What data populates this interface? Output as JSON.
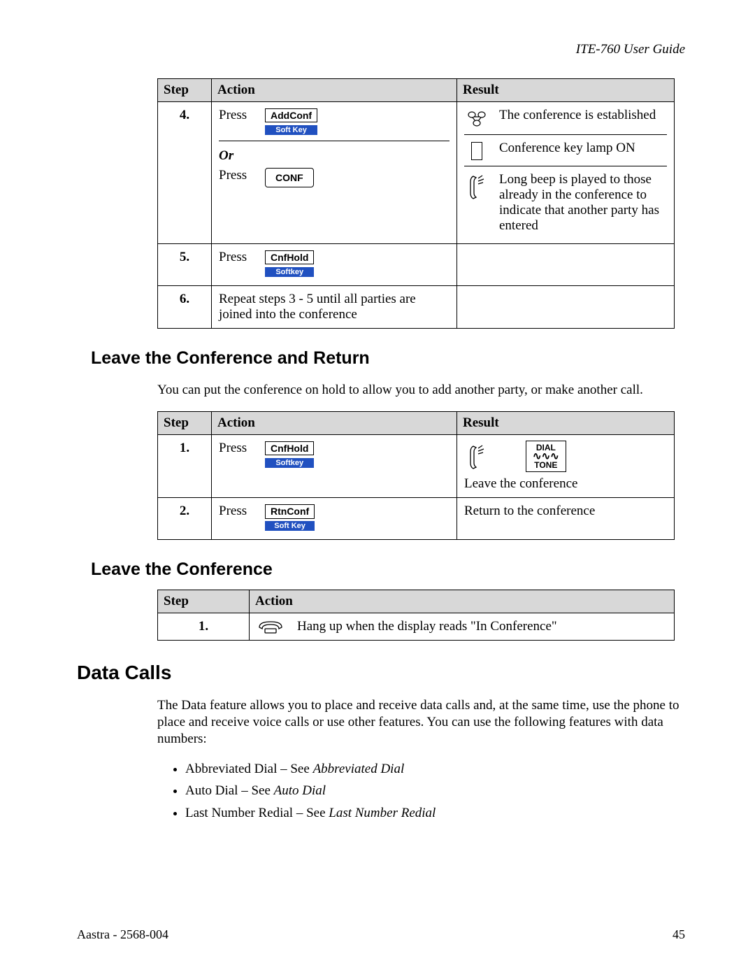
{
  "header": {
    "title": "ITE-760 User Guide"
  },
  "table1": {
    "headers": {
      "step": "Step",
      "action": "Action",
      "result": "Result"
    },
    "rows": [
      {
        "step": "4.",
        "press1": "Press",
        "key1": "AddConf",
        "softlabel1": "Soft Key",
        "or": "Or",
        "press2": "Press",
        "key2": "CONF",
        "r1": "The conference is established",
        "r2": "Conference key lamp ON",
        "r3": "Long beep is played to those already in the conference to indicate that another party has entered"
      },
      {
        "step": "5.",
        "press1": "Press",
        "key1": "CnfHold",
        "softlabel1": "Softkey"
      },
      {
        "step": "6.",
        "action_text": "Repeat steps 3 - 5 until all parties are joined into the conference"
      }
    ]
  },
  "section1": {
    "heading": "Leave the Conference and Return",
    "para": "You can put the conference on hold to allow you to add another party, or make another call."
  },
  "table2": {
    "headers": {
      "step": "Step",
      "action": "Action",
      "result": "Result"
    },
    "rows": [
      {
        "step": "1.",
        "press": "Press",
        "key": "CnfHold",
        "softlabel": "Softkey",
        "dial": "DIAL",
        "tone": "TONE",
        "result_text": "Leave the conference"
      },
      {
        "step": "2.",
        "press": "Press",
        "key": "RtnConf",
        "softlabel": "Soft Key",
        "result_text": "Return to the conference"
      }
    ]
  },
  "section2": {
    "heading": "Leave the Conference"
  },
  "table3": {
    "headers": {
      "step": "Step",
      "action": "Action"
    },
    "rows": [
      {
        "step": "1.",
        "action_text": "Hang up when the display reads \"In Conference\""
      }
    ]
  },
  "section3": {
    "heading": "Data Calls",
    "para": "The Data feature allows you to place and receive data calls and, at the same time, use the phone to place and receive voice calls or use other features.  You can use the following features with data numbers:",
    "bullets": [
      {
        "pre": "Abbreviated Dial – See ",
        "ital": "Abbreviated Dial"
      },
      {
        "pre": "Auto Dial – See ",
        "ital": "Auto Dial"
      },
      {
        "pre": "Last Number Redial – See ",
        "ital": "Last Number Redial"
      }
    ]
  },
  "footer": {
    "left": "Aastra - 2568-004",
    "right": "45"
  }
}
